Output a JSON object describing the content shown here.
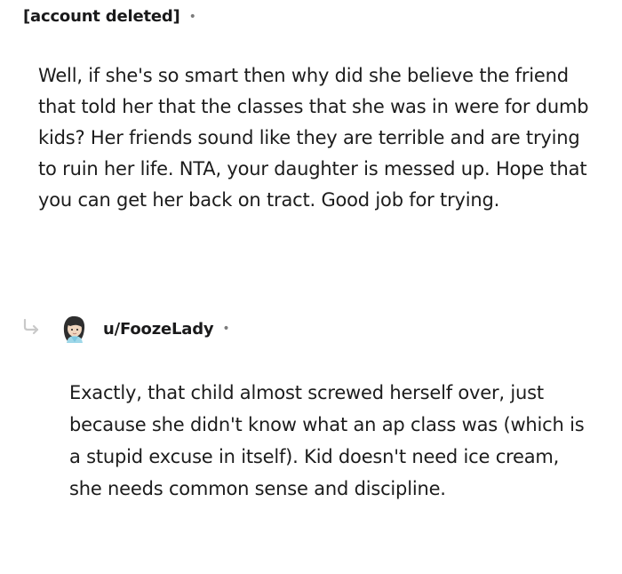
{
  "parent_comment": {
    "author": "[account deleted]",
    "separator": "•",
    "body": "Well, if she's so smart then why did she believe the friend that told her that the classes that she was in were for dumb kids? Her friends sound like they are terrible and are trying to ruin her life. NTA, your daughter is messed up. Hope that you can get her back on tract. Good job for trying."
  },
  "reply_comment": {
    "icon": "reply-arrow-icon",
    "avatar": "user-avatar",
    "author": "u/FoozeLady",
    "separator": "•",
    "body": "Exactly, that child almost screwed herself over, just because she didn't know what an ap class was (which is a stupid excuse in itself). Kid doesn't need ice cream, she needs common sense and discipline."
  },
  "colors": {
    "text": "#1c1c1c",
    "meta": "#7c7c7c",
    "reply_arrow": "#c9c9c9"
  }
}
